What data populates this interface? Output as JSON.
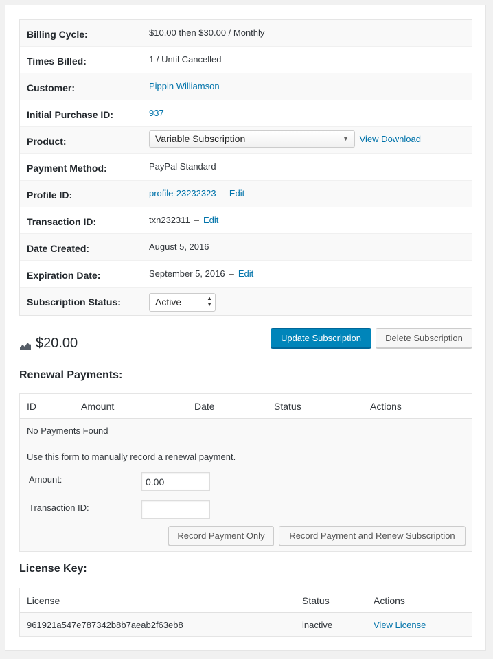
{
  "details": {
    "billing_cycle": {
      "label": "Billing Cycle:",
      "value": "$10.00 then $30.00 / Monthly"
    },
    "times_billed": {
      "label": "Times Billed:",
      "value": "1 / Until Cancelled"
    },
    "customer": {
      "label": "Customer:",
      "value": "Pippin Williamson"
    },
    "initial_purchase": {
      "label": "Initial Purchase ID:",
      "value": "937"
    },
    "product": {
      "label": "Product:",
      "selected": "Variable Subscription",
      "link": "View Download"
    },
    "payment_method": {
      "label": "Payment Method:",
      "value": "PayPal Standard"
    },
    "profile_id": {
      "label": "Profile ID:",
      "value": "profile-23232323",
      "separator": "–",
      "edit": "Edit"
    },
    "transaction_id": {
      "label": "Transaction ID:",
      "value": "txn232311",
      "separator": "–",
      "edit": "Edit"
    },
    "date_created": {
      "label": "Date Created:",
      "value": "August 5, 2016"
    },
    "expiration_date": {
      "label": "Expiration Date:",
      "value": "September 5, 2016",
      "separator": "–",
      "edit": "Edit"
    },
    "status": {
      "label": "Subscription Status:",
      "selected": "Active"
    }
  },
  "summary": {
    "price": "$20.00",
    "update_label": "Update Subscription",
    "delete_label": "Delete Subscription"
  },
  "renewals": {
    "title": "Renewal Payments:",
    "columns": [
      "ID",
      "Amount",
      "Date",
      "Status",
      "Actions"
    ],
    "empty": "No Payments Found",
    "hint": "Use this form to manually record a renewal payment.",
    "amount_label": "Amount:",
    "amount_value": "0.00",
    "txn_label": "Transaction ID:",
    "txn_value": "",
    "record_only": "Record Payment Only",
    "record_renew": "Record Payment and Renew Subscription"
  },
  "licenses": {
    "title": "License Key:",
    "columns": [
      "License",
      "Status",
      "Actions"
    ],
    "rows": [
      {
        "key": "961921a547e787342b8b7aeab2f63eb8",
        "status": "inactive",
        "action": "View License"
      }
    ]
  },
  "colors": {
    "link": "#0073aa",
    "primary": "#0085ba",
    "panel": "#ffffff",
    "stripe": "#f9f9f9"
  },
  "icons": [
    "chart-area-icon",
    "dropdown-arrow-icon",
    "stepper-icon"
  ]
}
